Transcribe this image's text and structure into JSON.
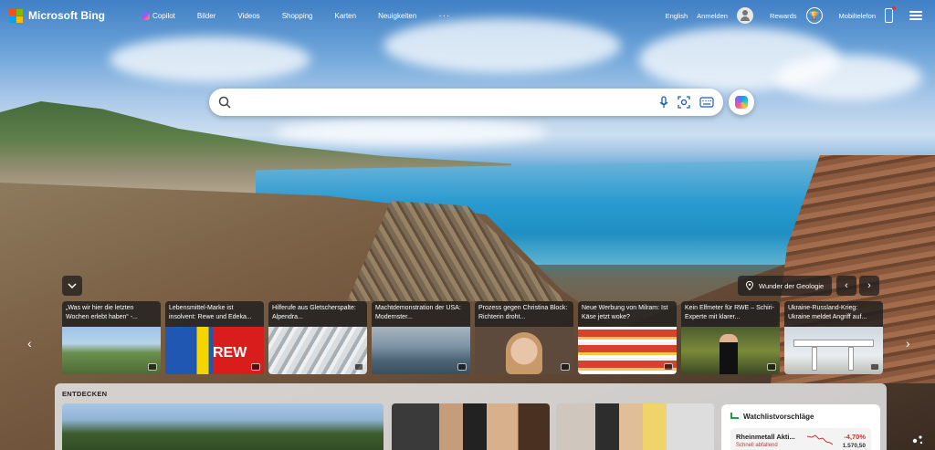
{
  "brand": {
    "name": "Microsoft Bing",
    "logo_colors": [
      "#f25022",
      "#7fba00",
      "#00a4ef",
      "#ffb900"
    ]
  },
  "nav": {
    "items": [
      {
        "label": "Copilot",
        "icon": "copilot-icon"
      },
      {
        "label": "Bilder"
      },
      {
        "label": "Videos"
      },
      {
        "label": "Shopping"
      },
      {
        "label": "Karten"
      },
      {
        "label": "Neuigkeiten"
      },
      {
        "label": "···"
      }
    ]
  },
  "account": {
    "language": "English",
    "signin": "Anmelden",
    "rewards": "Rewards",
    "mobile": "Mobiltelefon"
  },
  "search": {
    "placeholder": "",
    "value": ""
  },
  "background": {
    "location_label": "Wunder der Geologie"
  },
  "news": [
    {
      "title": "„Was wir hier die letzten Wochen erlebt haben“ -...",
      "image": "village"
    },
    {
      "title": "Lebensmittel-Marke ist insolvent: Rewe und Edeka...",
      "image": "supermarket"
    },
    {
      "title": "Hilferufe aus Gletscherspalte: Alpendra...",
      "image": "glacier"
    },
    {
      "title": "Machtdemonstration der USA: Modernster...",
      "image": "ship"
    },
    {
      "title": "Prozess gegen Christina Block: Richterin droht...",
      "image": "portrait"
    },
    {
      "title": "Neue Werbung von Milram: Ist Käse jetzt woke?",
      "image": "shelf"
    },
    {
      "title": "Kein Elfmeter für RWE – Schiri-Experte mit klarer...",
      "image": "referee"
    },
    {
      "title": "Ukraine-Russland-Krieg: Ukraine meldet Angriff auf...",
      "image": "pipeline"
    }
  ],
  "discover": {
    "title": "ENTDECKEN",
    "watchlist": {
      "title": "Watchlistvorschläge",
      "stock": {
        "name": "Rheinmetall Akti...",
        "subtitle": "Schnell abfallend",
        "change": "-4,70%",
        "price": "1.570,50"
      }
    }
  },
  "colors": {
    "accent": "#0078d4",
    "negative": "#c0392b",
    "positive": "#16a34a"
  }
}
